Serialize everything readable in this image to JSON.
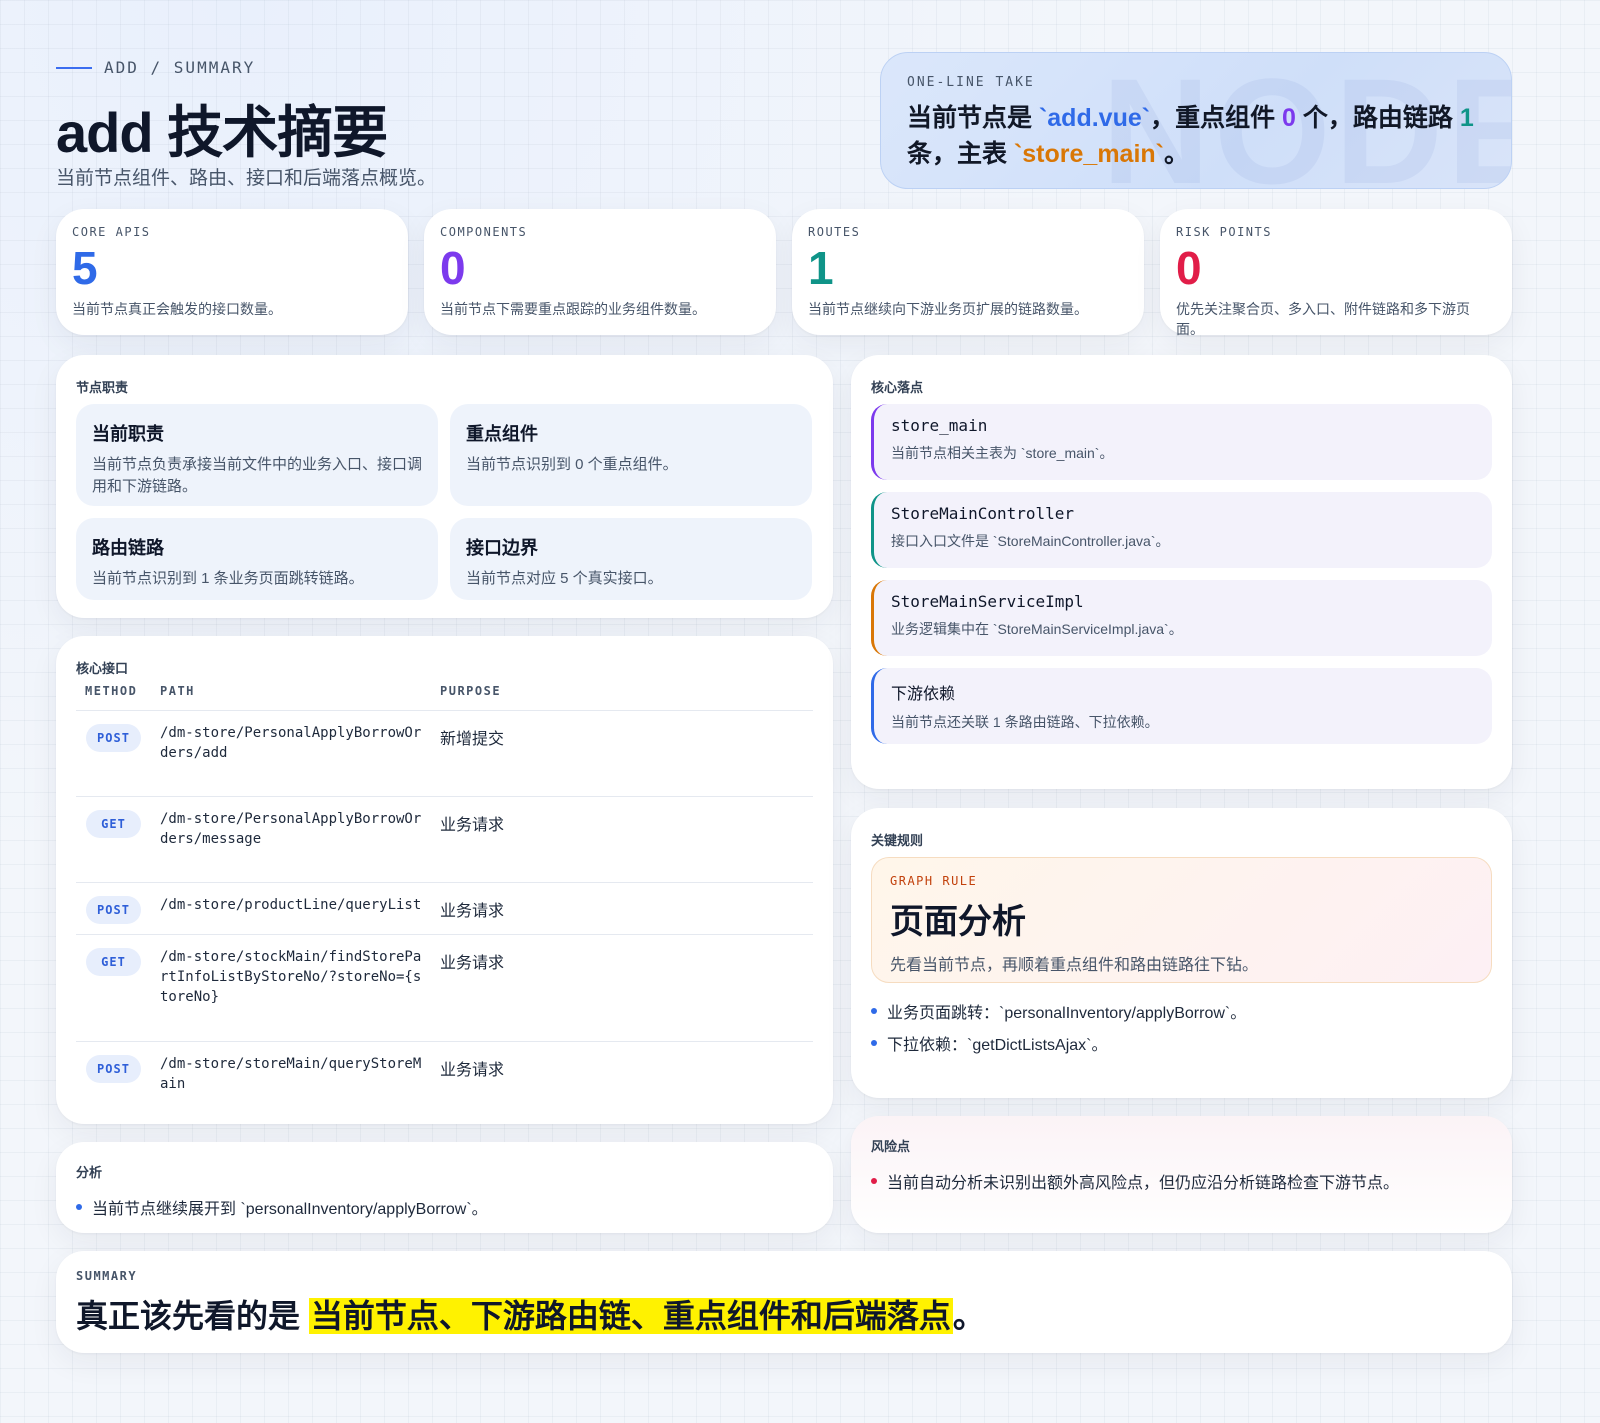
{
  "header": {
    "eyebrow": "ADD / SUMMARY",
    "title": "add 技术摘要",
    "subtitle": "当前节点组件、路由、接口和后端落点概览。"
  },
  "one_line_take": {
    "label": "ONE-LINE TAKE",
    "watermark": "NODE",
    "p1": "当前节点是 ",
    "file": "`add.vue`",
    "p2": "，重点组件 ",
    "components": "0",
    "p3": " 个，路由链路 ",
    "routes": "1",
    "p4": " 条，主表 ",
    "table": "`store_main`",
    "p5": "。"
  },
  "stats": [
    {
      "label": "CORE APIS",
      "value": "5",
      "desc": "当前节点真正会触发的接口数量。",
      "color": "#2f6ae8"
    },
    {
      "label": "COMPONENTS",
      "value": "0",
      "desc": "当前节点下需要重点跟踪的业务组件数量。",
      "color": "#7c3aed"
    },
    {
      "label": "ROUTES",
      "value": "1",
      "desc": "当前节点继续向下游业务页扩展的链路数量。",
      "color": "#0f9488"
    },
    {
      "label": "RISK POINTS",
      "value": "0",
      "desc": "优先关注聚合页、多入口、附件链路和多下游页面。",
      "color": "#e11d48"
    }
  ],
  "duty": {
    "title": "节点职责",
    "tiles": [
      {
        "title": "当前职责",
        "desc": "当前节点负责承接当前文件中的业务入口、接口调用和下游链路。"
      },
      {
        "title": "重点组件",
        "desc": "当前节点识别到 0 个重点组件。"
      },
      {
        "title": "路由链路",
        "desc": "当前节点识别到 1 条业务页面跳转链路。"
      },
      {
        "title": "接口边界",
        "desc": "当前节点对应 5 个真实接口。"
      }
    ]
  },
  "apis": {
    "title": "核心接口",
    "headers": {
      "method": "METHOD",
      "path": "PATH",
      "purpose": "PURPOSE"
    },
    "rows": [
      {
        "method": "POST",
        "path": "/dm-store/PersonalApplyBorrowOrders/add",
        "purpose": "新增提交"
      },
      {
        "method": "GET",
        "path": "/dm-store/PersonalApplyBorrowOrders/message",
        "purpose": "业务请求"
      },
      {
        "method": "POST",
        "path": "/dm-store/productLine/queryList",
        "purpose": "业务请求"
      },
      {
        "method": "GET",
        "path": "/dm-store/stockMain/findStorePartInfoListByStoreNo/?storeNo={storeNo}",
        "purpose": "业务请求"
      },
      {
        "method": "POST",
        "path": "/dm-store/storeMain/queryStoreMain",
        "purpose": "业务请求"
      }
    ]
  },
  "analysis": {
    "title": "分析",
    "items": [
      "当前节点继续展开到 `personalInventory/applyBorrow`。"
    ]
  },
  "core": {
    "title": "核心落点",
    "items": [
      {
        "title": "store_main",
        "desc": "当前节点相关主表为 `store_main`。",
        "color": "#7c3aed"
      },
      {
        "title": "StoreMainController",
        "desc": "接口入口文件是 `StoreMainController.java`。",
        "color": "#0f9488"
      },
      {
        "title": "StoreMainServiceImpl",
        "desc": "业务逻辑集中在 `StoreMainServiceImpl.java`。",
        "color": "#d97706"
      },
      {
        "title": "下游依赖",
        "desc": "当前节点还关联 1 条路由链路、下拉依赖。",
        "color": "#2f6ae8"
      }
    ]
  },
  "rules": {
    "title": "关键规则",
    "graph_label": "GRAPH RULE",
    "graph_title": "页面分析",
    "graph_desc": "先看当前节点，再顺着重点组件和路由链路往下钻。",
    "items": [
      "业务页面跳转：`personalInventory/applyBorrow`。",
      "下拉依赖：`getDictListsAjax`。"
    ]
  },
  "risk": {
    "title": "风险点",
    "items": [
      "当前自动分析未识别出额外高风险点，但仍应沿分析链路检查下游节点。"
    ]
  },
  "summary": {
    "label": "SUMMARY",
    "lead": "真正该先看的是 ",
    "highlight": "当前节点、下游路由链、重点组件和后端落点",
    "tail": "。"
  }
}
